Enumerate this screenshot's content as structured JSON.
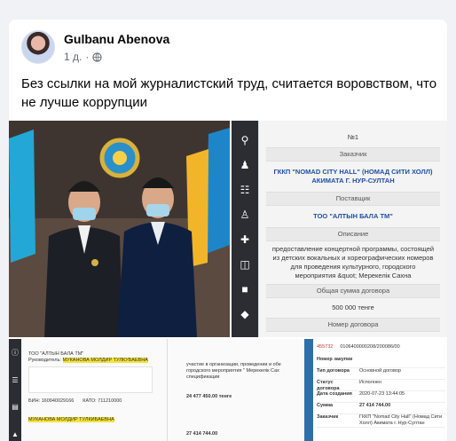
{
  "post": {
    "author": "Gulbanu Abenova",
    "time": "1 д.",
    "separator": "·",
    "text": "Без ссылки на мой журналистский труд, считается  воровством, что не лучше коррупции"
  },
  "doc": {
    "number": "№1",
    "customer_label": "Заказчик",
    "customer_value": "ГККП \"NOMAD CITY HALL\" (НОМАД СИТИ ХОЛЛ) АКИМАТА Г. НУР-СУЛТАН",
    "supplier_label": "Поставщик",
    "supplier_value": "ТОО \"АЛТЫН БАЛА ТМ\"",
    "description_label": "Описание",
    "description_value": "предоставление концертной программы, состоящей из детских вокальных и хореографических номеров для проведения культурного, городского мероприятия &quot; Мерекелік Сахна",
    "sum_label": "Общая сумма договора",
    "sum_value": "500 000 тенге",
    "contract_label": "Номер договора"
  },
  "strip_left": {
    "company": "ТОО \"АЛТЫН БАЛА ТМ\"",
    "director_label": "Руководитель:",
    "director_name": "МУКАНОВА МОЛДИР ТУЛКУБАЕВНА",
    "bin": "БИН: 160940029166",
    "kato": "КАТО: 711210000",
    "col_text": "участие в организации, проведении и обе городского мероприятия \" Мерекелік Сах спецификации",
    "amount1": "24 477 450.00 тенге",
    "director_name2": "МУКАНОВА МОЛДИР ТУЛКИБАЕВНА",
    "amount2": "27 414 744.00"
  },
  "strip_right": {
    "id": "455732",
    "code": "0106400000208/200086/00",
    "rows": [
      {
        "k": "Номер закупки",
        "v": ""
      },
      {
        "k": "Тип договора",
        "v": "Основной договор"
      },
      {
        "k": "Статус договора",
        "v": "Исполнен"
      },
      {
        "k": "Дата создания",
        "v": "2020-07-23 13:44:05"
      },
      {
        "k": "Сумма",
        "v": "27 414 744.00"
      },
      {
        "k": "Заказчик",
        "v": "ГККП \"Nomad City Hall\" (Номад Сити Холл) Акимата г. Нур-Султан"
      }
    ]
  }
}
